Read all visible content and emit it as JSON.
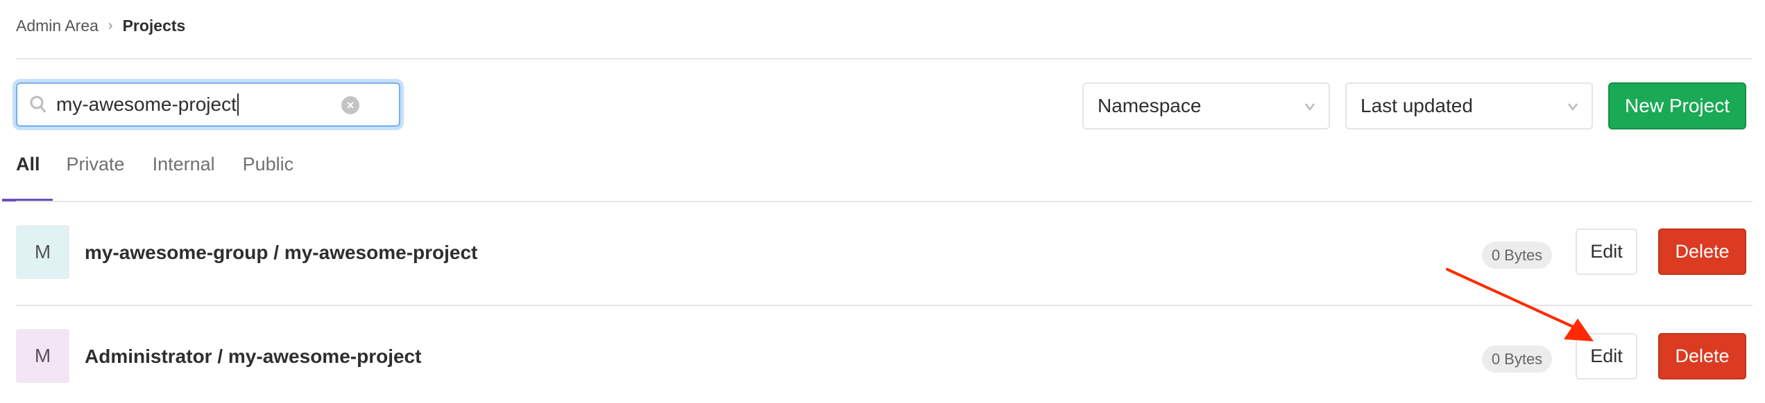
{
  "breadcrumb": {
    "parent": "Admin Area",
    "separator": "›",
    "current": "Projects"
  },
  "search": {
    "value": "my-awesome-project",
    "icon": "search-icon",
    "clear_icon": "clear-icon"
  },
  "filters": {
    "namespace": "Namespace",
    "sort": "Last updated"
  },
  "new_project_label": "New Project",
  "tabs": [
    {
      "label": "All",
      "active": true
    },
    {
      "label": "Private"
    },
    {
      "label": "Internal"
    },
    {
      "label": "Public"
    }
  ],
  "projects": [
    {
      "avatar": "M",
      "avatar_color": "#e0f2f1",
      "name": "my-awesome-group / my-awesome-project",
      "size": "0 Bytes",
      "edit": "Edit",
      "delete": "Delete"
    },
    {
      "avatar": "M",
      "avatar_color": "#f3e5f5",
      "name": "Administrator / my-awesome-project",
      "size": "0 Bytes",
      "edit": "Edit",
      "delete": "Delete"
    }
  ],
  "colors": {
    "primary_green": "#1aaa55",
    "danger_red": "#db3b21",
    "tab_accent": "#6b4fbb",
    "annotation_arrow": "#ff2a00"
  }
}
